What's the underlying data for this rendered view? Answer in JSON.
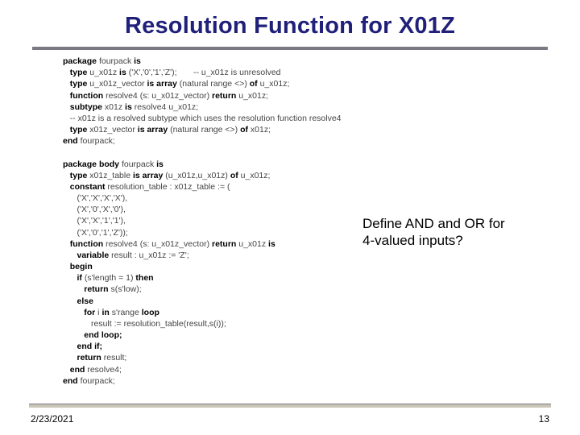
{
  "slide": {
    "title": "Resolution Function for X01Z",
    "annotation_line1": "Define AND and OR for",
    "annotation_line2": "4-valued inputs?",
    "footer": {
      "date": "2/23/2021",
      "page": "13"
    }
  },
  "code": {
    "l01a": "package",
    "l01b": " fourpack ",
    "l01c": "is",
    "l02a": "   type",
    "l02b": " u_x01z ",
    "l02c": "is",
    "l02d": " ('X','0','1','Z');       -- u_x01z is unresolved",
    "l03a": "   type",
    "l03b": " u_x01z_vector ",
    "l03c": "is array",
    "l03d": " (natural range <>) ",
    "l03e": "of",
    "l03f": " u_x01z;",
    "l04a": "   function",
    "l04b": " resolve4 (s: u_x01z_vector) ",
    "l04c": "return",
    "l04d": " u_x01z;",
    "l05a": "   subtype",
    "l05b": " x01z ",
    "l05c": "is",
    "l05d": " resolve4 u_x01z;",
    "l06": "   -- x01z is a resolved subtype which uses the resolution function resolve4",
    "l07a": "   type",
    "l07b": " x01z_vector ",
    "l07c": "is array",
    "l07d": " (natural range <>) ",
    "l07e": "of",
    "l07f": " x01z;",
    "l08a": "end",
    "l08b": " fourpack;",
    "blank1": "",
    "l09a": "package body",
    "l09b": " fourpack ",
    "l09c": "is",
    "l10a": "   type",
    "l10b": " x01z_table ",
    "l10c": "is array",
    "l10d": " (u_x01z,u_x01z) ",
    "l10e": "of",
    "l10f": " u_x01z;",
    "l11a": "   constant",
    "l11b": " resolution_table : x01z_table := (",
    "l12": "      ('X','X','X','X'),",
    "l13": "      ('X','0','X','0'),",
    "l14": "      ('X','X','1','1'),",
    "l15": "      ('X','0','1','Z'));",
    "l16a": "   function",
    "l16b": " resolve4 (s: u_x01z_vector) ",
    "l16c": "return",
    "l16d": " u_x01z ",
    "l16e": "is",
    "l17a": "      variable",
    "l17b": " result : u_x01z := 'Z';",
    "l18a": "   begin",
    "l19a": "      if",
    "l19b": " (s'length = 1) ",
    "l19c": "then",
    "l20a": "         return",
    "l20b": " s(s'low);",
    "l21a": "      else",
    "l22a": "         for",
    "l22b": " i ",
    "l22c": "in",
    "l22d": " s'range ",
    "l22e": "loop",
    "l23": "            result := resolution_table(result,s(i));",
    "l24a": "         end loop;",
    "l25a": "      end if;",
    "l26a": "      return",
    "l26b": " result;",
    "l27a": "   end",
    "l27b": " resolve4;",
    "l28a": "end",
    "l28b": " fourpack;"
  }
}
